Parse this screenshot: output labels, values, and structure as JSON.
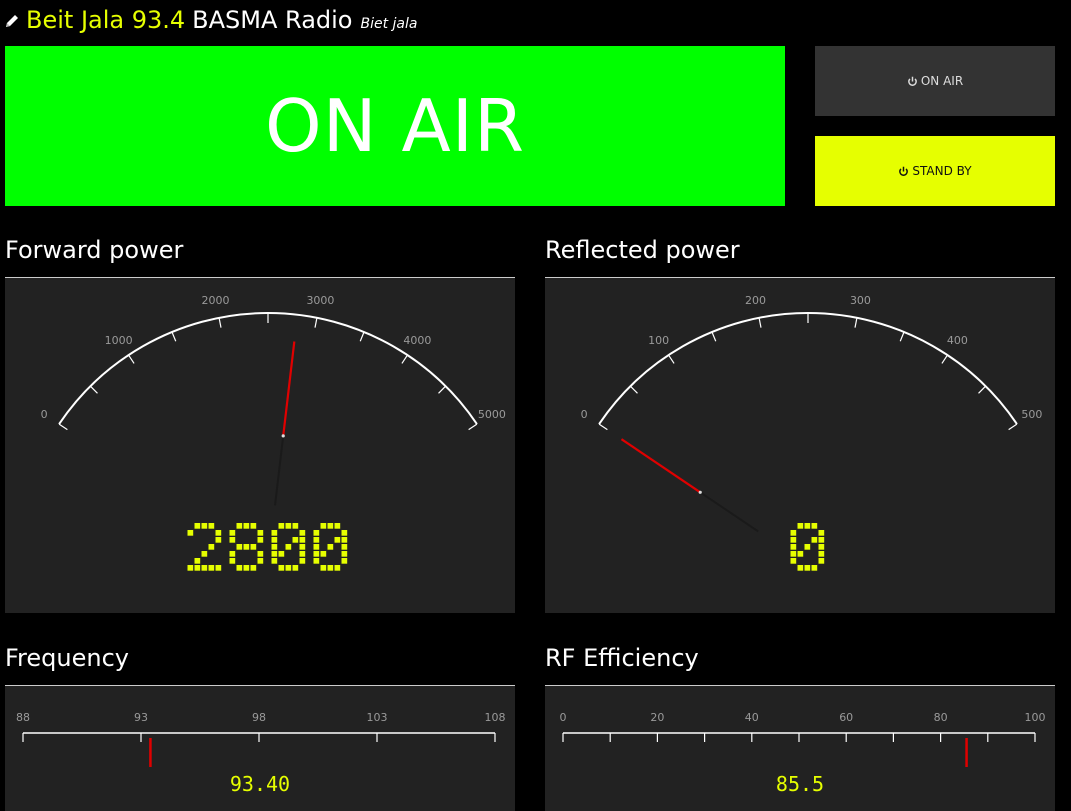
{
  "header": {
    "station_name": "Beit Jala 93.4",
    "brand": "BASMA Radio",
    "subtitle": "Biet jala",
    "icon": "pencil-icon"
  },
  "status": {
    "label": "ON AIR",
    "color": "#00ff00"
  },
  "controls": {
    "on_air_label": "ON AIR",
    "stand_by_label": "STAND BY",
    "icon": "power-icon",
    "stand_by_color": "#e6ff00"
  },
  "panels": {
    "forward": {
      "title": "Forward power",
      "value": 2800,
      "display": "2800",
      "min": 0,
      "max": 5000,
      "labels": [
        "0",
        "1000",
        "2000",
        "3000",
        "4000",
        "5000"
      ]
    },
    "reflected": {
      "title": "Reflected power",
      "value": 0,
      "display": "0",
      "min": 0,
      "max": 500,
      "labels": [
        "0",
        "100",
        "200",
        "300",
        "400",
        "500"
      ]
    },
    "frequency": {
      "title": "Frequency",
      "value": 93.4,
      "display": "93.40",
      "min": 88,
      "max": 108,
      "labels": [
        "88",
        "93",
        "98",
        "103",
        "108"
      ]
    },
    "efficiency": {
      "title": "RF Efficiency",
      "value": 85.5,
      "display": "85.5",
      "min": 0,
      "max": 100,
      "labels": [
        "0",
        "20",
        "40",
        "60",
        "80",
        "100"
      ]
    }
  },
  "colors": {
    "accent": "#e6ff00",
    "needle": "#e00000",
    "panel_bg": "#222222"
  }
}
